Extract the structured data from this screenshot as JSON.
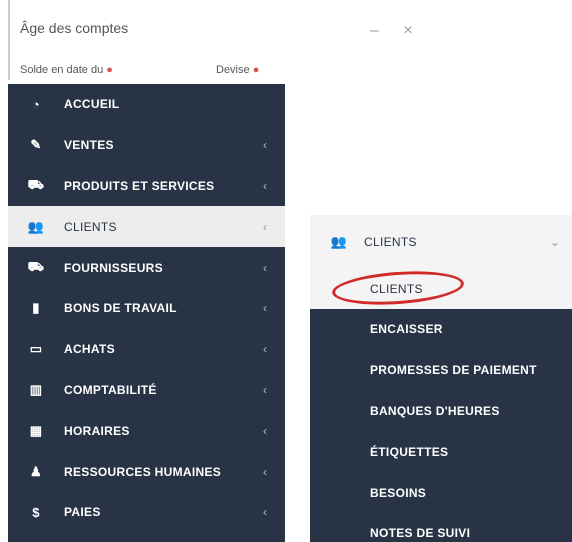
{
  "dialog": {
    "title": "Âge des comptes",
    "controls": "– ×",
    "subtitle_left": "Solde en date du",
    "subtitle_right": "Devise",
    "warn_mark": "●"
  },
  "sidebar": {
    "items": [
      {
        "label": "ACCUEIL",
        "icon": "dashboard-icon",
        "glyph": "◔",
        "chevron": ""
      },
      {
        "label": "VENTES",
        "icon": "edit-icon",
        "glyph": "✎",
        "chevron": "‹"
      },
      {
        "label": "PRODUITS ET SERVICES",
        "icon": "cart-icon",
        "glyph": "⛟",
        "chevron": "‹"
      },
      {
        "label": "CLIENTS",
        "icon": "users-icon",
        "glyph": "👥",
        "chevron": "‹"
      },
      {
        "label": "FOURNISSEURS",
        "icon": "truck-icon",
        "glyph": "⛟",
        "chevron": "‹"
      },
      {
        "label": "BONS DE TRAVAIL",
        "icon": "file-icon",
        "glyph": "▮",
        "chevron": "‹"
      },
      {
        "label": "ACHATS",
        "icon": "credit-card-icon",
        "glyph": "▭",
        "chevron": "‹"
      },
      {
        "label": "COMPTABILITÉ",
        "icon": "bar-chart-icon",
        "glyph": "▥",
        "chevron": "‹"
      },
      {
        "label": "HORAIRES",
        "icon": "calendar-icon",
        "glyph": "▦",
        "chevron": "‹"
      },
      {
        "label": "RESSOURCES HUMAINES",
        "icon": "user-icon",
        "glyph": "♟",
        "chevron": "‹"
      },
      {
        "label": "PAIES",
        "icon": "dollar-icon",
        "glyph": "$",
        "chevron": "‹"
      }
    ]
  },
  "submenu": {
    "header": {
      "label": "CLIENTS",
      "icon": "users-icon",
      "glyph": "👥",
      "chevron": "⌄"
    },
    "items": [
      {
        "label": "CLIENTS"
      },
      {
        "label": "ENCAISSER"
      },
      {
        "label": "PROMESSES DE PAIEMENT"
      },
      {
        "label": "BANQUES D'HEURES"
      },
      {
        "label": "ÉTIQUETTES"
      },
      {
        "label": "BESOINS"
      },
      {
        "label": "NOTES DE SUIVI"
      }
    ]
  },
  "colors": {
    "sidebar_bg": "#283446",
    "active_bg": "#ededed",
    "highlight_circle": "#d12a2a"
  }
}
